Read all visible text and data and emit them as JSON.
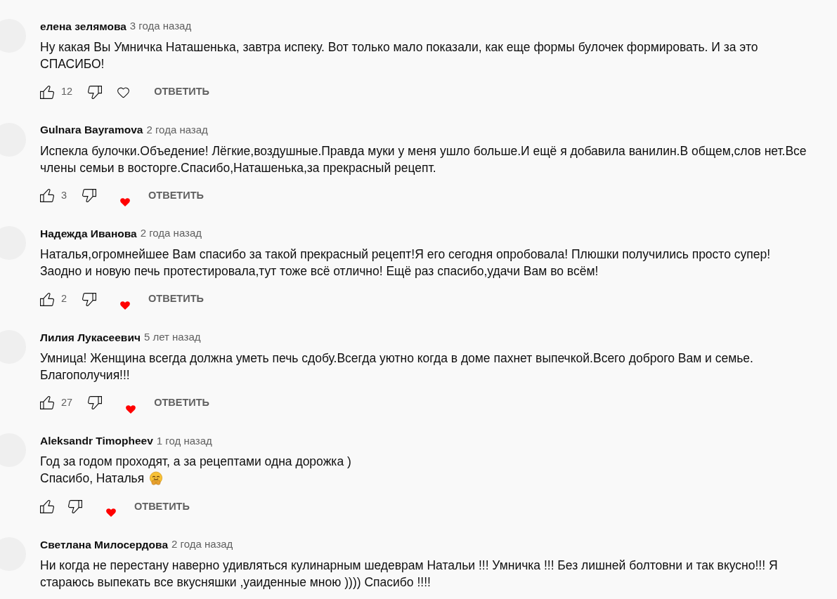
{
  "comments": [
    {
      "author": "елена зелямова",
      "time": "3 года назад",
      "text_lines": [
        "Ну какая Вы Умничка Наташенька, завтра испеку. Вот только мало показали, как еще формы булочек формировать. И за это",
        "СПАСИБО!"
      ],
      "actions": {
        "likes": "12",
        "creator_heart": false,
        "reply": "ОТВЕТИТЬ"
      }
    },
    {
      "author": "Gulnara Bayramova",
      "time": "2 года назад",
      "text_lines": [
        "Испекла булочки.Объедение! Лёгкие,воздушные.Правда муки у меня ушло больше.И ещё я добавила ванилин.В общем,слов нет.Все",
        "члены семьи в восторге.Спасибо,Наташенька,за прекрасный рецепт."
      ],
      "actions": {
        "likes": "3",
        "creator_heart": true,
        "reply": "ОТВЕТИТЬ"
      }
    },
    {
      "author": "Надежда Иванова",
      "time": "2 года назад",
      "text_lines": [
        "Наталья,огромнейшее Вам спасибо за такой прекрасный рецепт!Я его сегодня опробовала! Плюшки получились просто супер!",
        "Заодно и новую печь протестировала,тут тоже всё отлично! Ещё раз спасибо,удачи Вам во всём!"
      ],
      "actions": {
        "likes": "2",
        "creator_heart": true,
        "reply": "ОТВЕТИТЬ"
      }
    },
    {
      "author": "Лилия Лукасеевич",
      "time": "5 лет назад",
      "text_lines": [
        "Умница! Женщина всегда должна уметь печь сдобу.Всегда уютно когда в доме пахнет выпечкой.Всего доброго Вам и семье.",
        "Благополучия!!!"
      ],
      "actions": {
        "likes": "27",
        "creator_heart": true,
        "reply": "ОТВЕТИТЬ"
      }
    },
    {
      "author": "Aleksandr Timopheev",
      "time": "1 год назад",
      "text_lines": [
        "Год за годом проходят, а за рецептами одна дорожка )",
        "Спасибо, Наталья"
      ],
      "trailing_emoji": {
        "kind": "hugging_face"
      },
      "actions": {
        "creator_heart": true,
        "reply": "ОТВЕТИТЬ"
      }
    },
    {
      "author": "Светлана Милосердова",
      "time": "2 года назад",
      "text_lines": [
        "Ни когда не перестану наверно удивляться кулинарным шедеврам Натальи !!! Умничка !!! Без лишней болтовни и так вкусно!!! Я",
        "стараюсь выпекать все вкусняшки ,уаиденные мною )))) Спасибо !!!!"
      ]
    }
  ]
}
